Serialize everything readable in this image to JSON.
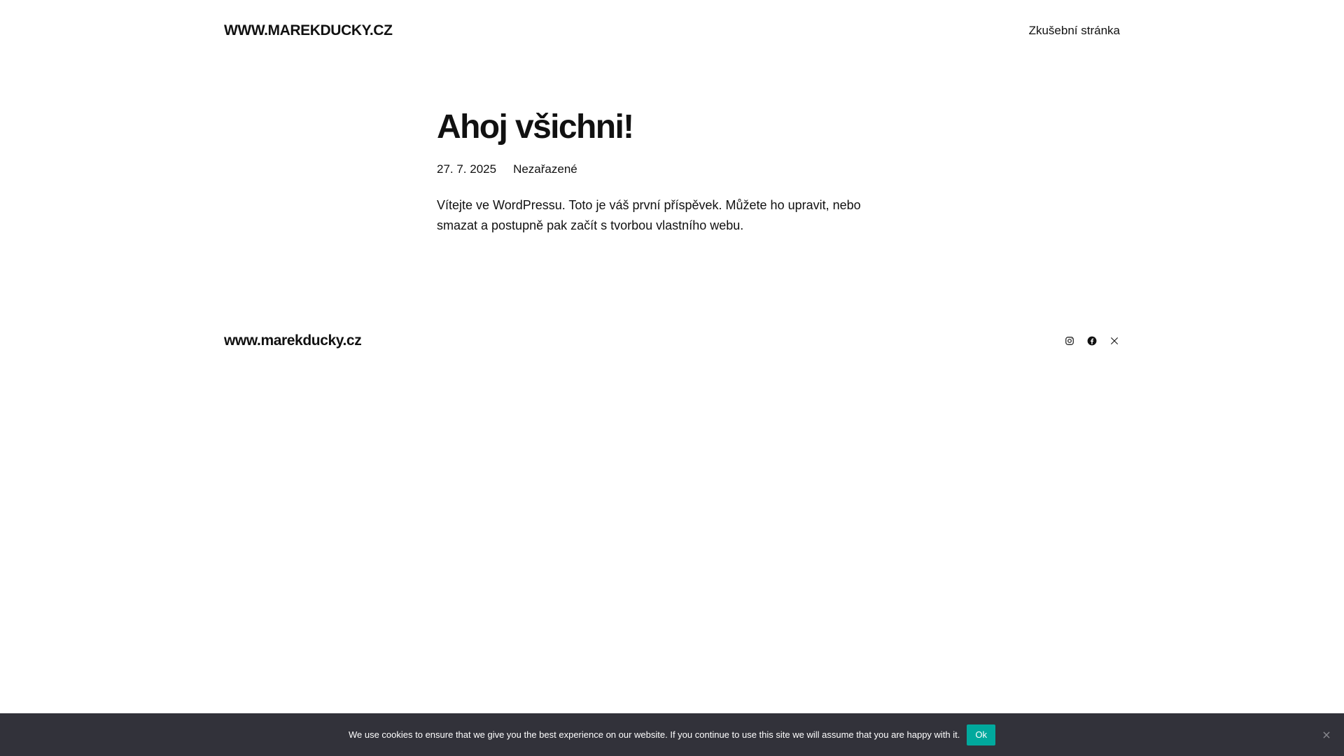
{
  "header": {
    "site_title": "WWW.MAREKDUCKY.CZ",
    "nav_link": "Zkušební stránka"
  },
  "post": {
    "title": "Ahoj všichni!",
    "date": "27. 7. 2025",
    "category": "Nezařazené",
    "content": "Vítejte ve WordPressu. Toto je váš první příspěvek. Můžete ho upravit, nebo smazat a postupně pak začít s tvorbou vlastního webu."
  },
  "footer": {
    "site_title": "www.marekducky.cz",
    "social_icons": [
      "instagram-icon",
      "facebook-icon",
      "x-icon"
    ]
  },
  "cookie_bar": {
    "message": "We use cookies to ensure that we give you the best experience on our website. If you continue to use this site we will assume that you are happy with it.",
    "ok_label": "Ok",
    "background_color": "#32323a",
    "ok_color": "#00a99d"
  }
}
